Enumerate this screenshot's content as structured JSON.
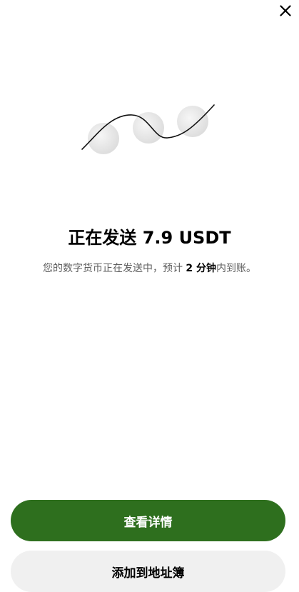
{
  "header": {
    "close_icon": "close-icon"
  },
  "status": {
    "title": "正在发送 7.9 USDT",
    "subtitle_prefix": "您的数字货币正在发送中，预计 ",
    "subtitle_time": "2 分钟",
    "subtitle_suffix": "内到账。"
  },
  "actions": {
    "view_details_label": "查看详情",
    "add_to_address_book_label": "添加到地址簿"
  },
  "colors": {
    "primary_button": "#2e6f1e",
    "secondary_button": "#f0f0f0",
    "subtitle_text": "#5f5f5f"
  },
  "illustration": {
    "icon": "sending-coins-illustration"
  }
}
